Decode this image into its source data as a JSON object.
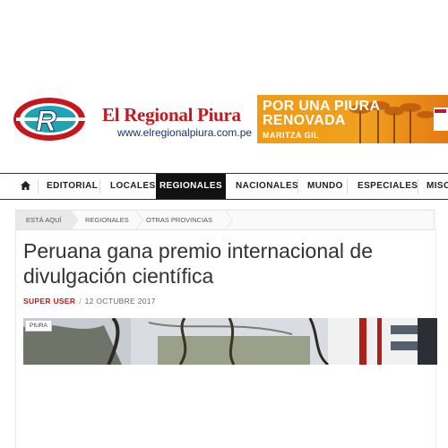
{
  "header": {
    "logo_title": "El Regional Piura",
    "logo_url": "www.elregionalpiura.com.pe"
  },
  "ad": {
    "line1": "POR UNA PIURA",
    "line2": "RENOVADA",
    "name": "MARITZA GIL"
  },
  "nav": {
    "home_icon": "home-icon",
    "items": [
      "EDITORIAL",
      "LOCALES",
      "REGIONALES",
      "NACIONALES",
      "MUNDO",
      "ESPECIALES",
      "MISC"
    ],
    "active": "REGIONALES"
  },
  "breadcrumb": {
    "here": "ESTÁ AQUÍ",
    "items": [
      "REGIONALES",
      "OTRAS PROVINCIAS"
    ]
  },
  "article": {
    "title": "Peruana gana premio internacional de divulgación científica",
    "author": "SUPER USER",
    "separator": "/",
    "date": "12 OCTUBRE 2017",
    "photo_tag": "PIURA"
  },
  "colors": {
    "brand_red": "#c8161d",
    "brand_navy": "#17356b",
    "ad_orange": "#f19a12",
    "nav_active_bg": "#111111"
  }
}
